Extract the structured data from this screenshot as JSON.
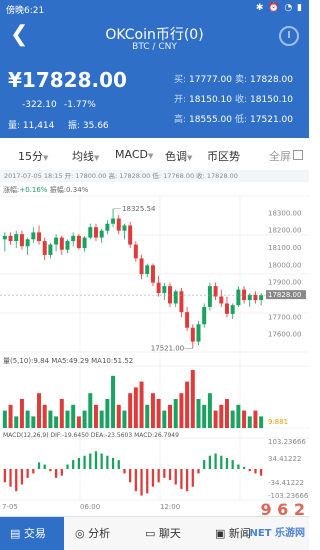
{
  "status_bar": {
    "time": "傍晚6:21",
    "icons": "✱ ⏰ ◔ ▮"
  },
  "header": {
    "back": "❮",
    "title": "OKCoin币行(0)",
    "subtitle": "BTC / CNY"
  },
  "ticker": {
    "symbol": "¥",
    "last": "17828.00",
    "change": "-322.10",
    "change_pct": "-1.77%",
    "volume": "量: 11,414",
    "range": "振: 35.66",
    "rows": [
      {
        "l1": "买:",
        "v1": "17777.00",
        "l2": "卖:",
        "v2": "17828.00"
      },
      {
        "l1": "开:",
        "v1": "18150.10",
        "l2": "收:",
        "v2": "18150.10"
      },
      {
        "l1": "高:",
        "v1": "18555.00",
        "l2": "低:",
        "v2": "17521.00"
      }
    ]
  },
  "tabs": [
    {
      "label": "15分"
    },
    {
      "label": "均线"
    },
    {
      "label": "MACD"
    },
    {
      "label": "色调"
    },
    {
      "label": "币区势"
    }
  ],
  "fullscreen": "全屏",
  "infobar": "2017-07-05 18:15  开: 17800.00  高: 17828.00  低: 17768.00  收: 17828.00",
  "legend_top": {
    "label": "涨幅:",
    "value": "+0.16%",
    "amp": "振幅:0.34%"
  },
  "legend_vol": "量(5,10):9.84  MA5:49.29  MA10:51.52",
  "legend_macd": "MACD(12,26,9)  DIF:-19.6450  DEA:-23.5603  MACD:26.7949",
  "colors": {
    "up": "#1aa260",
    "down": "#e03b3b",
    "brand": "#2f6fc7"
  },
  "chart_data": {
    "type": "candlestick",
    "y_ticks": [
      "18300.00",
      "18200.00",
      "18100.00",
      "18000.00",
      "17900.00",
      "17828.00",
      "17700.00",
      "17600.00"
    ],
    "high_label": "18325.54",
    "low_label": "17521.00",
    "vol_ticks": [
      "9.881"
    ],
    "macd_ticks": [
      "103.23666",
      "34.41222",
      "-34.41222",
      "-103.23666"
    ],
    "x_ticks": [
      "7-05",
      "06:00",
      "12:00"
    ],
    "candles": [
      [
        18150,
        18190,
        18080,
        18170
      ],
      [
        18170,
        18190,
        18120,
        18140
      ],
      [
        18140,
        18200,
        18100,
        18180
      ],
      [
        18180,
        18200,
        18090,
        18110
      ],
      [
        18110,
        18160,
        18060,
        18150
      ],
      [
        18150,
        18220,
        18130,
        18190
      ],
      [
        18190,
        18230,
        18120,
        18140
      ],
      [
        18140,
        18160,
        18030,
        18060
      ],
      [
        18060,
        18130,
        18040,
        18120
      ],
      [
        18120,
        18180,
        18080,
        18160
      ],
      [
        18160,
        18170,
        18060,
        18090
      ],
      [
        18090,
        18150,
        18070,
        18140
      ],
      [
        18140,
        18190,
        18110,
        18170
      ],
      [
        18170,
        18180,
        18090,
        18100
      ],
      [
        18100,
        18170,
        18080,
        18160
      ],
      [
        18160,
        18240,
        18150,
        18220
      ],
      [
        18220,
        18240,
        18140,
        18160
      ],
      [
        18160,
        18210,
        18130,
        18200
      ],
      [
        18200,
        18260,
        18180,
        18240
      ],
      [
        18240,
        18326,
        18220,
        18270
      ],
      [
        18270,
        18290,
        18180,
        18200
      ],
      [
        18200,
        18240,
        18150,
        18230
      ],
      [
        18230,
        18250,
        18100,
        18120
      ],
      [
        18120,
        18140,
        18020,
        18040
      ],
      [
        18040,
        18060,
        17920,
        17950
      ],
      [
        17950,
        18010,
        17930,
        18000
      ],
      [
        18000,
        18010,
        17880,
        17900
      ],
      [
        17900,
        17940,
        17820,
        17840
      ],
      [
        17840,
        17900,
        17800,
        17880
      ],
      [
        17880,
        17900,
        17760,
        17780
      ],
      [
        17780,
        17860,
        17760,
        17850
      ],
      [
        17850,
        17870,
        17700,
        17730
      ],
      [
        17730,
        17760,
        17620,
        17640
      ],
      [
        17640,
        17660,
        17521,
        17560
      ],
      [
        17560,
        17680,
        17540,
        17660
      ],
      [
        17660,
        17780,
        17640,
        17760
      ],
      [
        17760,
        17900,
        17740,
        17880
      ],
      [
        17880,
        17900,
        17800,
        17820
      ],
      [
        17820,
        17860,
        17760,
        17780
      ],
      [
        17780,
        17820,
        17700,
        17720
      ],
      [
        17720,
        17780,
        17690,
        17770
      ],
      [
        17770,
        17880,
        17760,
        17860
      ],
      [
        17860,
        17880,
        17780,
        17800
      ],
      [
        17800,
        17840,
        17760,
        17830
      ],
      [
        17830,
        17850,
        17780,
        17800
      ],
      [
        17800,
        17840,
        17770,
        17828
      ]
    ],
    "volumes": [
      3,
      4,
      2,
      5,
      3,
      2,
      6,
      4,
      3,
      2,
      5,
      3,
      4,
      2,
      3,
      6,
      4,
      3,
      5,
      9,
      4,
      3,
      6,
      7,
      8,
      4,
      6,
      5,
      3,
      4,
      5,
      6,
      8,
      10,
      5,
      4,
      6,
      3,
      4,
      5,
      3,
      4,
      3,
      2,
      3,
      2
    ],
    "macd": [
      -30,
      -40,
      -50,
      -35,
      -20,
      -10,
      15,
      10,
      -5,
      -20,
      -15,
      10,
      20,
      25,
      30,
      35,
      40,
      35,
      30,
      25,
      20,
      -10,
      -30,
      -50,
      -60,
      -55,
      -40,
      -30,
      -20,
      -25,
      -35,
      -45,
      -50,
      -40,
      -10,
      20,
      30,
      35,
      30,
      25,
      20,
      10,
      5,
      -5,
      -10,
      -15
    ]
  },
  "bottom_nav": [
    {
      "label": "交易"
    },
    {
      "label": "分析"
    },
    {
      "label": "聊天"
    },
    {
      "label": "新闻"
    }
  ],
  "watermark": {
    "logo": "9 6 2",
    "domain": ".NET",
    "site": "乐游网"
  }
}
